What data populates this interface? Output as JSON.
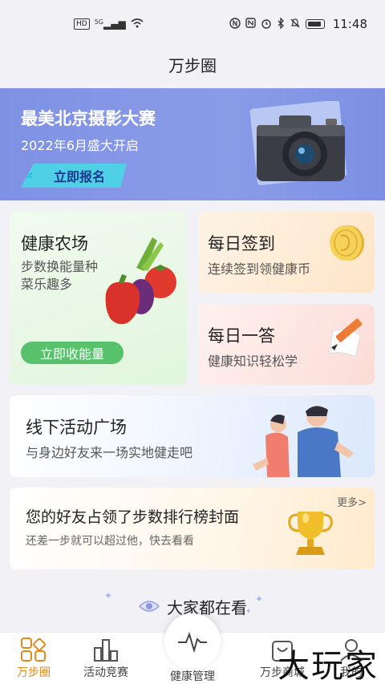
{
  "status_bar": {
    "left_badge": "HD",
    "signal": "5G",
    "time": "11:48",
    "icons": [
      "hd-icon",
      "signal-icon",
      "wifi-icon",
      "nfc-icon",
      "alarm-icon",
      "bluetooth-icon",
      "mute-icon",
      "battery-icon"
    ]
  },
  "header": {
    "title": "万步圈"
  },
  "banner": {
    "title": "最美北京摄影大赛",
    "subtitle": "2022年6月盛大开启",
    "button_label": "立即报名",
    "image": "camera"
  },
  "cards": {
    "farm": {
      "title": "健康农场",
      "subtitle": "步数换能量种菜乐趣多",
      "button_label": "立即收能量",
      "image": "vegetables"
    },
    "checkin": {
      "title": "每日签到",
      "subtitle": "连续签到领健康币",
      "image": "coin"
    },
    "quiz": {
      "title": "每日一答",
      "subtitle": "健康知识轻松学",
      "image": "pencil"
    },
    "activity": {
      "title": "线下活动广场",
      "subtitle": "与身边好友来一场实地健走吧",
      "image": "runners"
    },
    "ranking": {
      "title": "您的好友占领了步数排行榜封面",
      "subtitle": "还差一步就可以超过他，快去看看",
      "more_label": "更多>",
      "image": "trophy"
    }
  },
  "section": {
    "title": "大家都在看"
  },
  "tabbar": {
    "items": [
      {
        "label": "万步圈",
        "icon": "grid-icon",
        "active": true
      },
      {
        "label": "活动竞赛",
        "icon": "bar-chart-icon",
        "active": false
      },
      {
        "label": "健康管理",
        "icon": "pulse-icon",
        "active": false
      },
      {
        "label": "万步商城",
        "icon": "shop-icon",
        "active": false
      },
      {
        "label": "我的",
        "icon": "user-icon",
        "active": false
      }
    ]
  },
  "watermark": "大玩家",
  "colors": {
    "accent": "#e28a1a",
    "banner": "#8293e4",
    "green_button": "#57c26b"
  }
}
